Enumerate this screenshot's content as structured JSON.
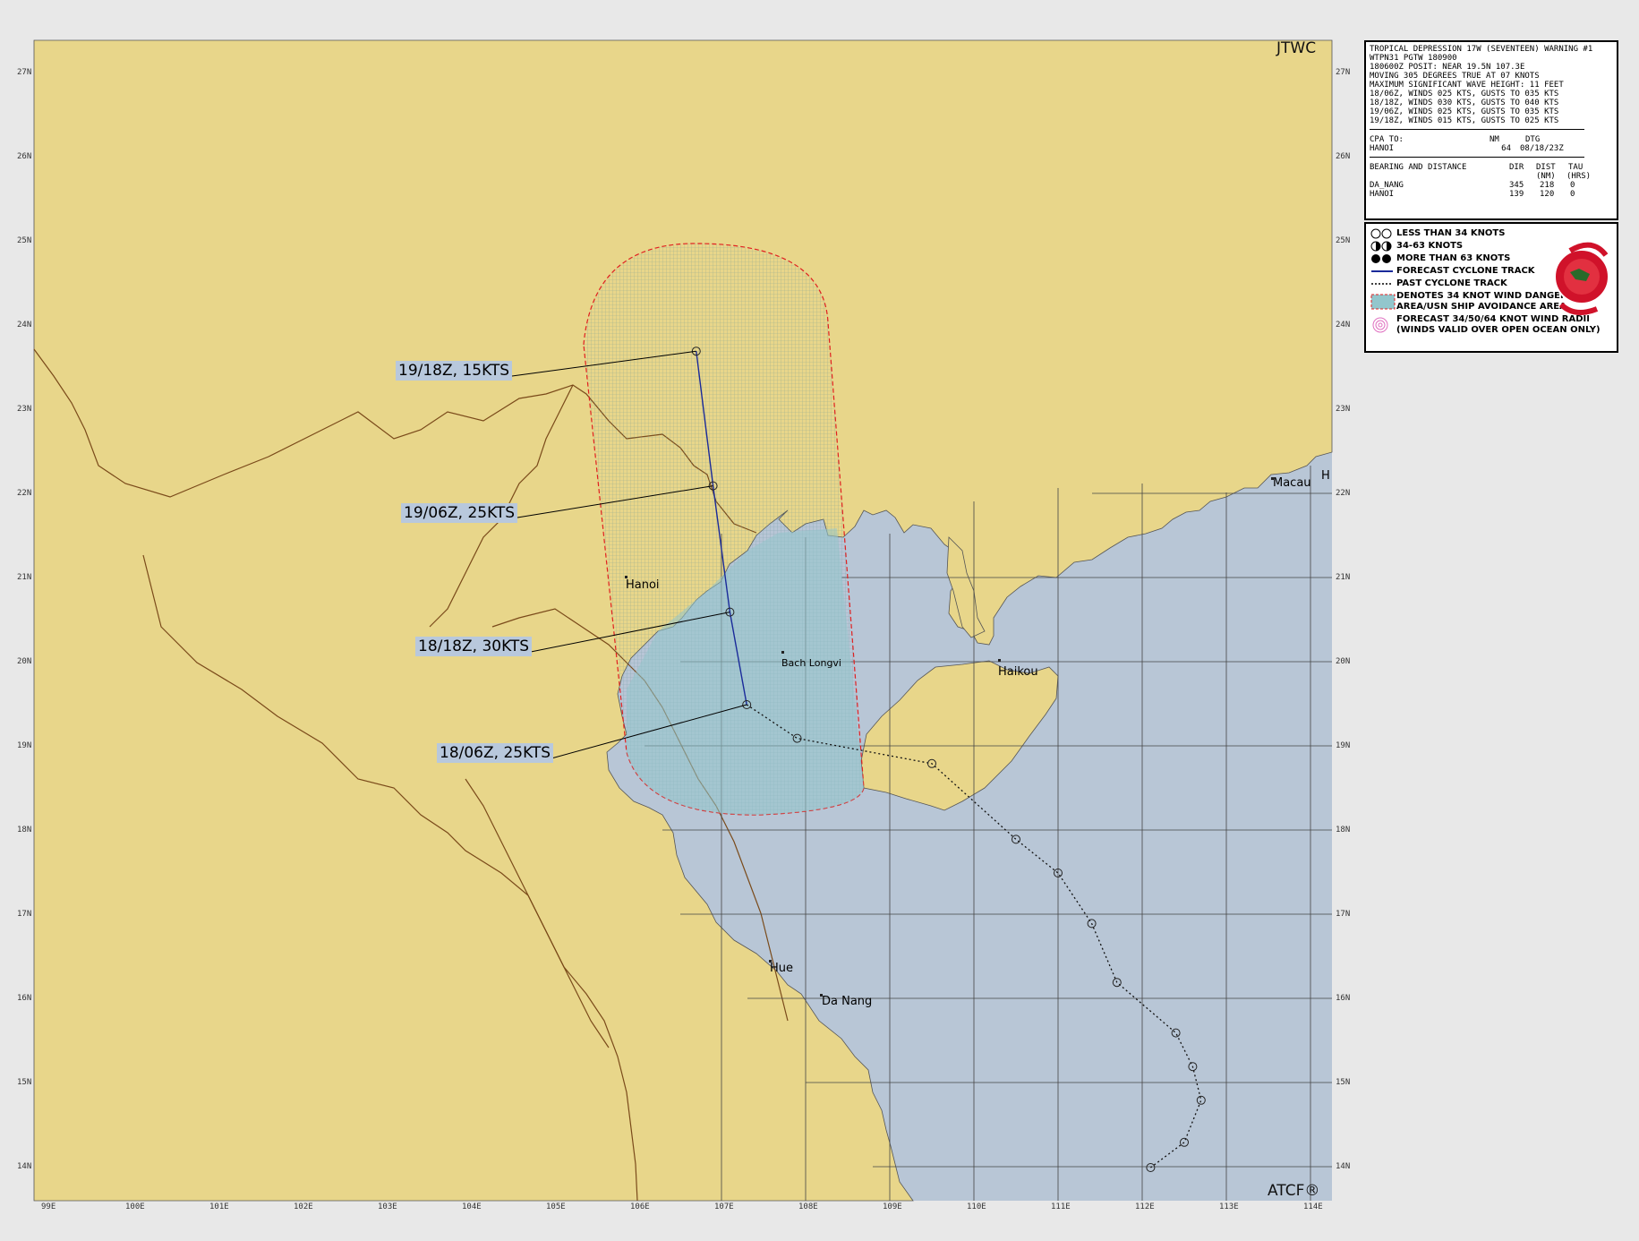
{
  "header": {
    "top_right_label": "JTWC",
    "bottom_right_label": "ATCF®"
  },
  "info": {
    "lines": [
      "TROPICAL DEPRESSION 17W (SEVENTEEN) WARNING #1",
      "WTPN31 PGTW 180900",
      "180600Z POSIT: NEAR 19.5N 107.3E",
      "MOVING 305 DEGREES TRUE AT 07 KNOTS",
      "MAXIMUM SIGNIFICANT WAVE HEIGHT: 11 FEET",
      "18/06Z, WINDS 025 KTS, GUSTS TO 035 KTS",
      "18/18Z, WINDS 030 KTS, GUSTS TO 040 KTS",
      "19/06Z, WINDS 025 KTS, GUSTS TO 035 KTS",
      "19/18Z, WINDS 015 KTS, GUSTS TO 025 KTS"
    ],
    "cpa": {
      "header": [
        "CPA TO:",
        "NM",
        "DTG"
      ],
      "rows": [
        [
          "HANOI",
          "64",
          "08/18/23Z"
        ]
      ]
    },
    "bearing": {
      "header": [
        "BEARING AND DISTANCE",
        "DIR",
        "DIST",
        "TAU"
      ],
      "units": [
        "",
        "",
        "(NM)",
        "(HRS)"
      ],
      "rows": [
        [
          "DA_NANG",
          "345",
          "218",
          "0"
        ],
        [
          "HANOI",
          "139",
          "120",
          "0"
        ]
      ]
    }
  },
  "legend": {
    "items": [
      "LESS THAN 34 KNOTS",
      "34-63 KNOTS",
      "MORE THAN 63 KNOTS",
      "FORECAST CYCLONE TRACK",
      "PAST CYCLONE TRACK",
      "DENOTES 34 KNOT WIND DANGER",
      "AREA/USN SHIP AVOIDANCE AREA",
      "FORECAST 34/50/64 KNOT WIND RADII",
      "(WINDS VALID OVER OPEN OCEAN ONLY)"
    ]
  },
  "map": {
    "lat_ticks": [
      "27N",
      "26N",
      "25N",
      "24N",
      "23N",
      "22N",
      "21N",
      "20N",
      "19N",
      "18N",
      "17N",
      "16N",
      "15N",
      "14N"
    ],
    "lon_ticks": [
      "99E",
      "100E",
      "101E",
      "102E",
      "103E",
      "104E",
      "105E",
      "106E",
      "107E",
      "108E",
      "109E",
      "110E",
      "111E",
      "112E",
      "113E",
      "114E"
    ],
    "colors": {
      "land": "#e8d68a",
      "sea": "#b8c6d6",
      "danger": "#93c6cc",
      "track": "#1a2a9a",
      "border": "#7a4a1a"
    },
    "cities": [
      "Hanoi",
      "Bach Longvi",
      "Haikou",
      "Macau",
      "Hue",
      "Da Nang",
      "H"
    ],
    "forecast_points": [
      {
        "tau": "18/06Z",
        "wind": "25KTS",
        "label": "18/06Z,  25KTS",
        "lat": 19.5,
        "lon": 107.3
      },
      {
        "tau": "18/18Z",
        "wind": "30KTS",
        "label": "18/18Z,  30KTS",
        "lat": 20.6,
        "lon": 107.1
      },
      {
        "tau": "19/06Z",
        "wind": "25KTS",
        "label": "19/06Z,  25KTS",
        "lat": 22.1,
        "lon": 106.9
      },
      {
        "tau": "19/18Z",
        "wind": "15KTS",
        "label": "19/18Z,  15KTS",
        "lat": 23.7,
        "lon": 106.7
      }
    ],
    "past_points": [
      {
        "lat": 19.1,
        "lon": 107.9
      },
      {
        "lat": 18.8,
        "lon": 109.5
      },
      {
        "lat": 17.9,
        "lon": 110.5
      },
      {
        "lat": 17.5,
        "lon": 111.0
      },
      {
        "lat": 16.9,
        "lon": 111.4
      },
      {
        "lat": 16.2,
        "lon": 111.7
      },
      {
        "lat": 15.6,
        "lon": 112.4
      },
      {
        "lat": 15.2,
        "lon": 112.6
      },
      {
        "lat": 14.8,
        "lon": 112.7
      },
      {
        "lat": 14.3,
        "lon": 112.5
      },
      {
        "lat": 14.0,
        "lon": 112.1
      }
    ]
  }
}
